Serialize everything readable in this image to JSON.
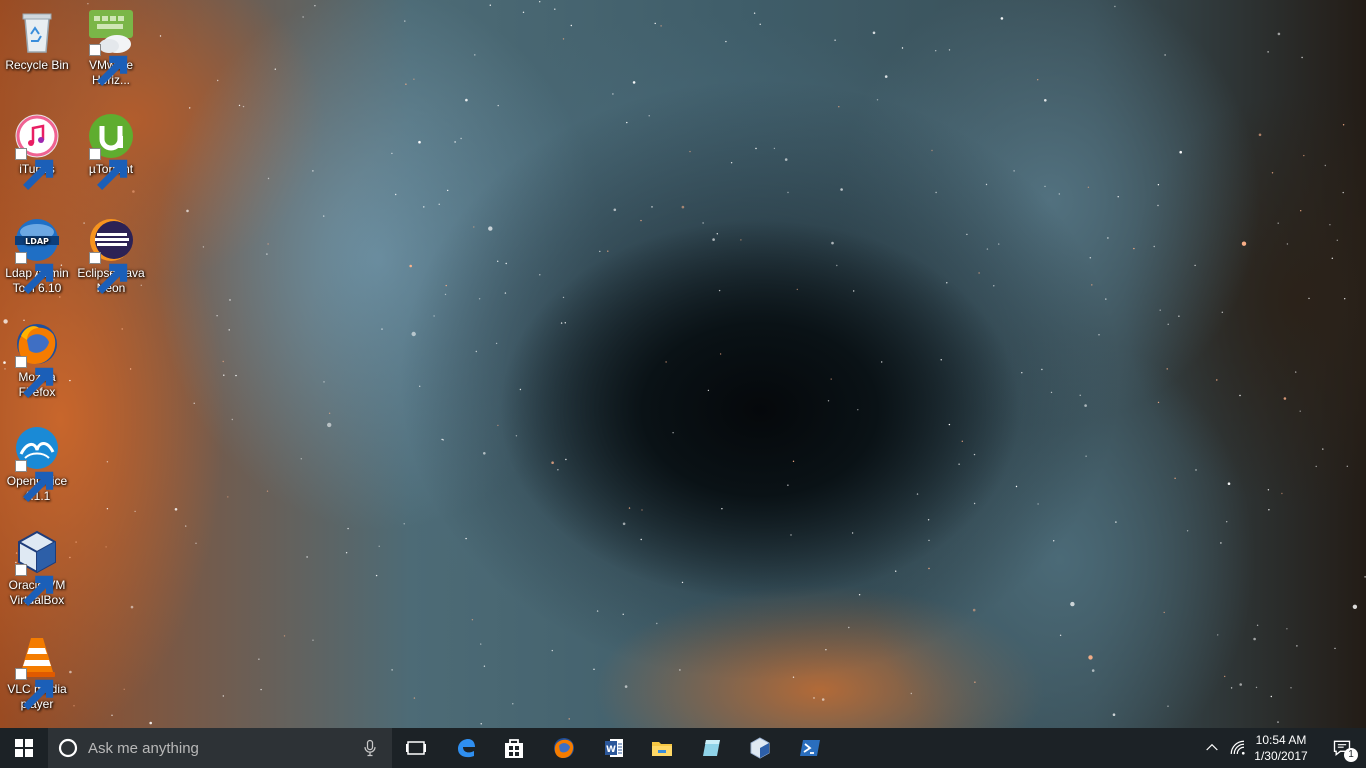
{
  "desktop": {
    "icons": [
      {
        "label": "Recycle Bin",
        "icon": "recycle-bin-icon"
      },
      {
        "label": "VMware Horiz...",
        "icon": "vmware-horizon-icon"
      },
      {
        "label": "iTunes",
        "icon": "itunes-icon"
      },
      {
        "label": "µTorrent",
        "icon": "utorrent-icon"
      },
      {
        "label": "Ldap Admin Tool 6.10",
        "icon": "ldap-admin-icon"
      },
      {
        "label": "Eclipse Java Neon",
        "icon": "eclipse-icon"
      },
      {
        "label": "Mozilla Firefox",
        "icon": "firefox-icon"
      },
      {
        "label": "OpenOffice 4.1.1",
        "icon": "openoffice-icon"
      },
      {
        "label": "Oracle VM VirtualBox",
        "icon": "virtualbox-icon"
      },
      {
        "label": "VLC media player",
        "icon": "vlc-icon"
      }
    ]
  },
  "taskbar": {
    "search_placeholder": "Ask me anything",
    "pinned": [
      "task-view-icon",
      "edge-icon",
      "store-icon",
      "firefox-icon",
      "word-icon",
      "file-explorer-icon",
      "app-icon",
      "virtualbox-icon",
      "powershell-icon"
    ],
    "clock": {
      "time": "10:54 AM",
      "date": "1/30/2017"
    },
    "notification_count": "1"
  }
}
